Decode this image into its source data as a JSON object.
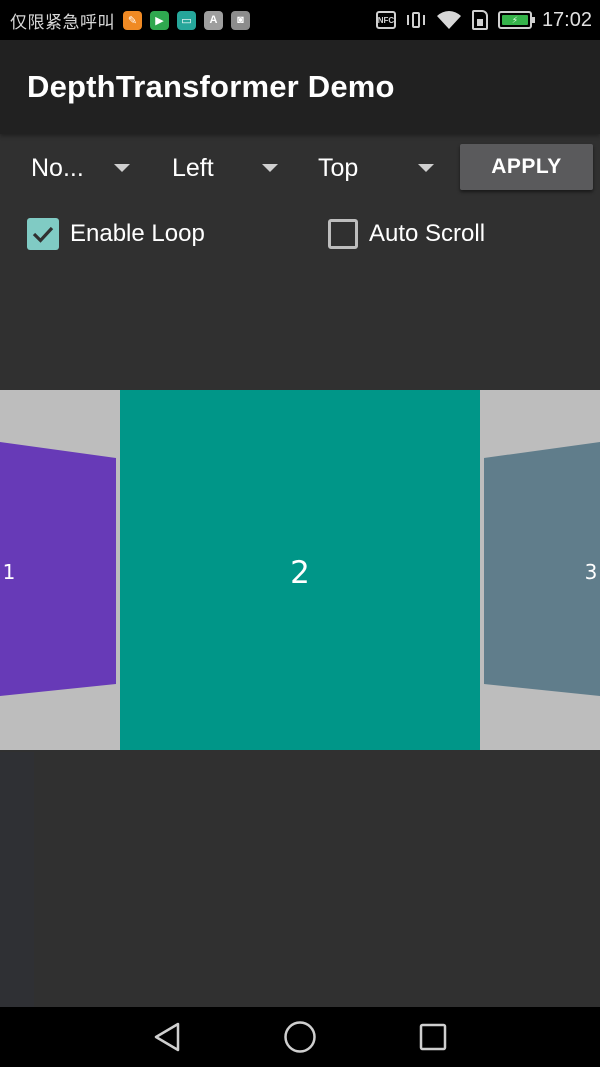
{
  "status_bar": {
    "carrier": "仅限紧急呼叫",
    "notifications": [
      {
        "icon": "orange-app-icon",
        "color": "#f08a24",
        "glyph": "✎"
      },
      {
        "icon": "play-store-icon",
        "color": "#2fa84f",
        "glyph": "▶"
      },
      {
        "icon": "teal-app-icon",
        "color": "#26a69a",
        "glyph": "▭"
      },
      {
        "icon": "a-app-icon",
        "color": "#9e9e9e",
        "glyph": "A"
      },
      {
        "icon": "grey-app-icon",
        "color": "#8c8c8c",
        "glyph": "◙"
      }
    ],
    "nfc_label": "NFC",
    "time": "17:02"
  },
  "app_bar": {
    "title": "DepthTransformer Demo"
  },
  "controls": {
    "spinner1": {
      "value": "No..."
    },
    "spinner2": {
      "value": "Left"
    },
    "spinner3": {
      "value": "Top"
    },
    "apply_label": "APPLY",
    "enable_loop": {
      "label": "Enable Loop",
      "checked": true
    },
    "auto_scroll": {
      "label": "Auto Scroll",
      "checked": false
    }
  },
  "pager": {
    "pages": [
      {
        "label": "1",
        "color": "#673ab7"
      },
      {
        "label": "2",
        "color": "#009688"
      },
      {
        "label": "3",
        "color": "#607d8b"
      }
    ],
    "current_page": "2",
    "background": "#bdbdbd"
  },
  "nav_bar": {
    "buttons": [
      "back-icon",
      "home-icon",
      "recents-icon"
    ]
  }
}
